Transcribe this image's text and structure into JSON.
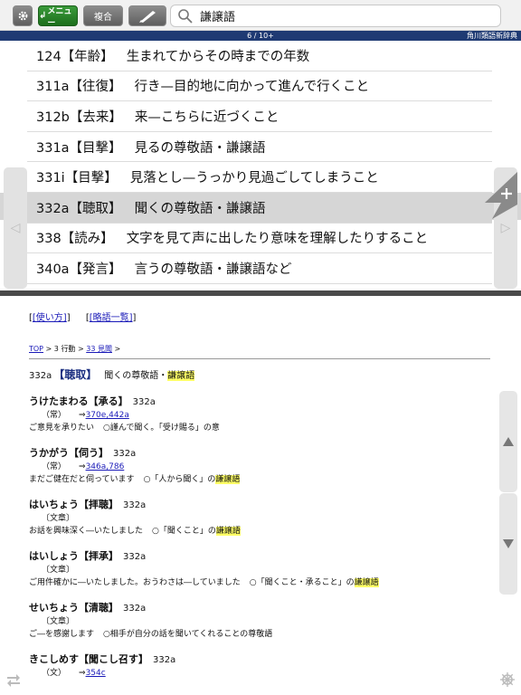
{
  "toolbar": {
    "menu_label": "メニュー",
    "compound_label": "複合",
    "search_value": "謙譲語"
  },
  "status": {
    "count": "6 / 10+",
    "dictionary": "角川類語新辞典"
  },
  "results": [
    {
      "code": "124【年齢】",
      "text": "生まれてからその時までの年数"
    },
    {
      "code": "311a【往復】",
      "text": "行き—目的地に向かって進んで行くこと"
    },
    {
      "code": "312b【去来】",
      "text": "来—こちらに近づくこと"
    },
    {
      "code": "331a【目撃】",
      "text": "見るの尊敬語・謙譲語"
    },
    {
      "code": "331i【目撃】",
      "text": "見落とし—うっかり見過ごしてしまうこと"
    },
    {
      "code": "332a【聴取】",
      "text": "聞くの尊敬語・謙譲語"
    },
    {
      "code": "338【読み】",
      "text": "文字を見て声に出したり意味を理解したりすること"
    },
    {
      "code": "340a【発言】",
      "text": "言うの尊敬語・謙譲語など"
    }
  ],
  "detail": {
    "links": [
      "[使い方]",
      "[略語一覧]"
    ],
    "breadcrumb": {
      "top": "TOP",
      "sep1": " > 3 行動 > ",
      "section": "33 見聞",
      "sep2": " >"
    },
    "heading": {
      "code": "332a",
      "bracket": "【聴取】",
      "desc_prefix": "聞くの尊敬語・",
      "desc_hl": "謙譲語"
    },
    "entries": [
      {
        "title": "うけたまわる【承る】",
        "num": "332a",
        "label": "（常）",
        "ref": "370e,442a",
        "ex": "ご意見を承りたい",
        "note": "○謹んで聞く。「受け賜る」の意",
        "note_hl": ""
      },
      {
        "title": "うかがう【伺う】",
        "num": "332a",
        "label": "（常）",
        "ref": "346a,786",
        "ex": "まだご健在だと伺っています",
        "note": "○「人から聞く」の",
        "note_hl": "謙譲語"
      },
      {
        "title": "はいちょう【拝聴】",
        "num": "332a",
        "label": "〔文章〕",
        "ref": "",
        "ex": "お話を興味深く―いたしました",
        "note": "○「聞くこと」の",
        "note_hl": "謙譲語"
      },
      {
        "title": "はいしょう【拝承】",
        "num": "332a",
        "label": "〔文章〕",
        "ref": "",
        "ex": "ご用件確かに―いたしました。おうわさは―していました",
        "note": "○「聞くこと・承ること」の",
        "note_hl": "謙譲語"
      },
      {
        "title": "せいちょう【清聴】",
        "num": "332a",
        "label": "〔文章〕",
        "ref": "",
        "ex": "ご―を感謝します",
        "note": "○相手が自分の話を聞いてくれることの尊敬語",
        "note_hl": ""
      },
      {
        "title": "きこしめす【聞こし召す】",
        "num": "332a",
        "label": "（文）",
        "ref": "354c",
        "ex": "",
        "note": "",
        "note_hl": ""
      }
    ]
  },
  "colors": {
    "status_bar": "#1f3a73",
    "highlight": "#ffff66",
    "menu_green": "#2a8a2a",
    "link": "#1a1ab8"
  }
}
